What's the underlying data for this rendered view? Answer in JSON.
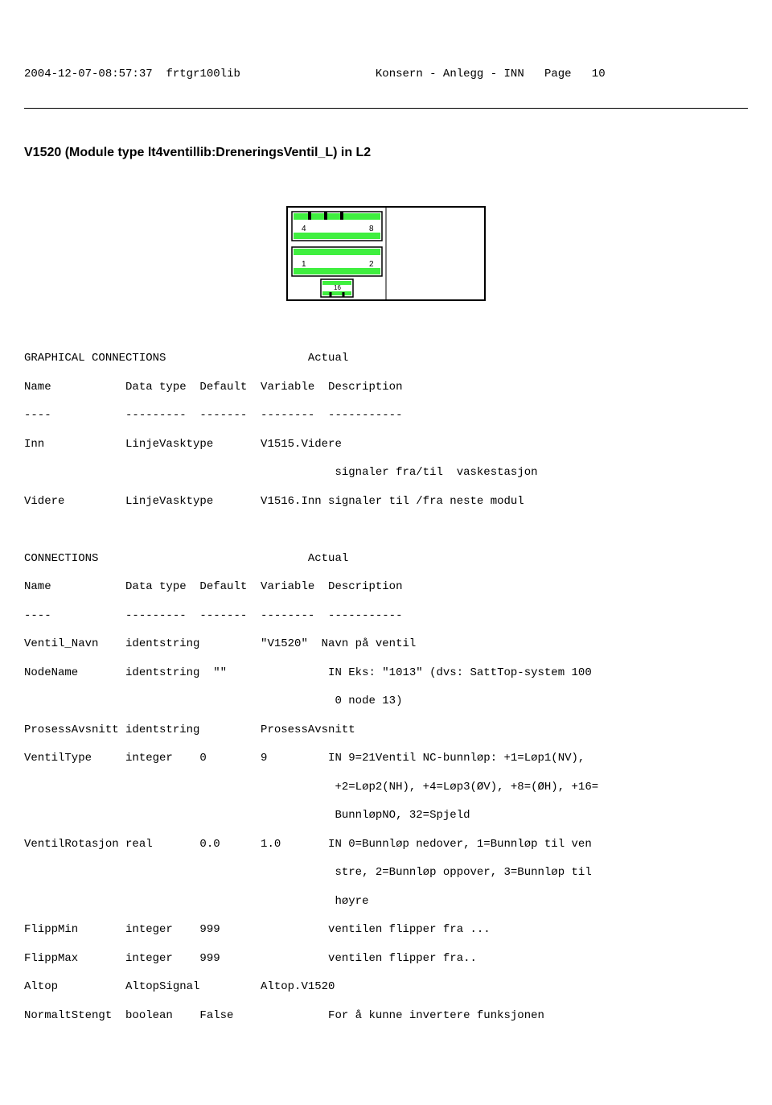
{
  "header": {
    "timestamp": "2004-12-07-08:57:37",
    "lib": "frtgr100lib",
    "title": "Konsern - Anlegg - INN",
    "page_label": "Page",
    "page_num": "10"
  },
  "module_title": "V1520 (Module type lt4ventillib:DreneringsVentil_L) in L2",
  "diagram": {
    "labels": {
      "tl": "4",
      "tr": "8",
      "ml": "1",
      "mr": "2",
      "bottom": "16"
    }
  },
  "gconn": {
    "title": "GRAPHICAL CONNECTIONS                     Actual",
    "head": "Name           Data type  Default  Variable  Description",
    "sep": "----           ---------  -------  --------  -----------",
    "r1": "Inn            LinjeVasktype       V1515.Videre",
    "r1b": "                                              signaler fra/til  vaskestasjon",
    "r2": "Videre         LinjeVasktype       V1516.Inn signaler til /fra neste modul"
  },
  "conn": {
    "title": "CONNECTIONS                               Actual",
    "head": "Name           Data type  Default  Variable  Description",
    "sep": "----           ---------  -------  --------  -----------",
    "r1": "Ventil_Navn    identstring         \"V1520\"  Navn på ventil",
    "r2": "NodeName       identstring  \"\"               IN Eks: \"1013\" (dvs: SattTop-system 100",
    "r2b": "                                              0 node 13)",
    "r3": "ProsessAvsnitt identstring         ProsessAvsnitt",
    "r4": "VentilType     integer    0        9         IN 9=21Ventil NC-bunnløp: +1=Løp1(NV),",
    "r4b": "                                              +2=Løp2(NH), +4=Løp3(ØV), +8=(ØH), +16=",
    "r4c": "                                              BunnløpNO, 32=Spjeld",
    "r5": "VentilRotasjon real       0.0      1.0       IN 0=Bunnløp nedover, 1=Bunnløp til ven",
    "r5b": "                                              stre, 2=Bunnløp oppover, 3=Bunnløp til",
    "r5c": "                                              høyre",
    "r6": "FlippMin       integer    999                ventilen flipper fra ...",
    "r7": "FlippMax       integer    999                ventilen flipper fra..",
    "r8": "Altop          AltopSignal         Altop.V1520",
    "r9": "NormaltStengt  boolean    False              For å kunne invertere funksjonen"
  },
  "chart_data": {
    "type": "table",
    "title": "CONNECTIONS",
    "columns": [
      "Name",
      "Data type",
      "Default",
      "Actual Variable",
      "Description"
    ],
    "rows": [
      [
        "Ventil_Navn",
        "identstring",
        "",
        "\"V1520\"",
        "Navn på ventil"
      ],
      [
        "NodeName",
        "identstring",
        "\"\"",
        "",
        "IN Eks: \"1013\" (dvs: SattTop-system 1000 node 13)"
      ],
      [
        "ProsessAvsnitt",
        "identstring",
        "",
        "ProsessAvsnitt",
        ""
      ],
      [
        "VentilType",
        "integer",
        "0",
        "9",
        "IN 9=21Ventil NC-bunnløp: +1=Løp1(NV), +2=Løp2(NH), +4=Løp3(ØV), +8=(ØH), +16=BunnløpNO, 32=Spjeld"
      ],
      [
        "VentilRotasjon",
        "real",
        "0.0",
        "1.0",
        "IN 0=Bunnløp nedover, 1=Bunnløp til venstre, 2=Bunnløp oppover, 3=Bunnløp til høyre"
      ],
      [
        "FlippMin",
        "integer",
        "999",
        "",
        "ventilen flipper fra ..."
      ],
      [
        "FlippMax",
        "integer",
        "999",
        "",
        "ventilen flipper fra.."
      ],
      [
        "Altop",
        "AltopSignal",
        "",
        "Altop.V1520",
        ""
      ],
      [
        "NormaltStengt",
        "boolean",
        "False",
        "",
        "For å kunne invertere funksjonen"
      ]
    ]
  }
}
